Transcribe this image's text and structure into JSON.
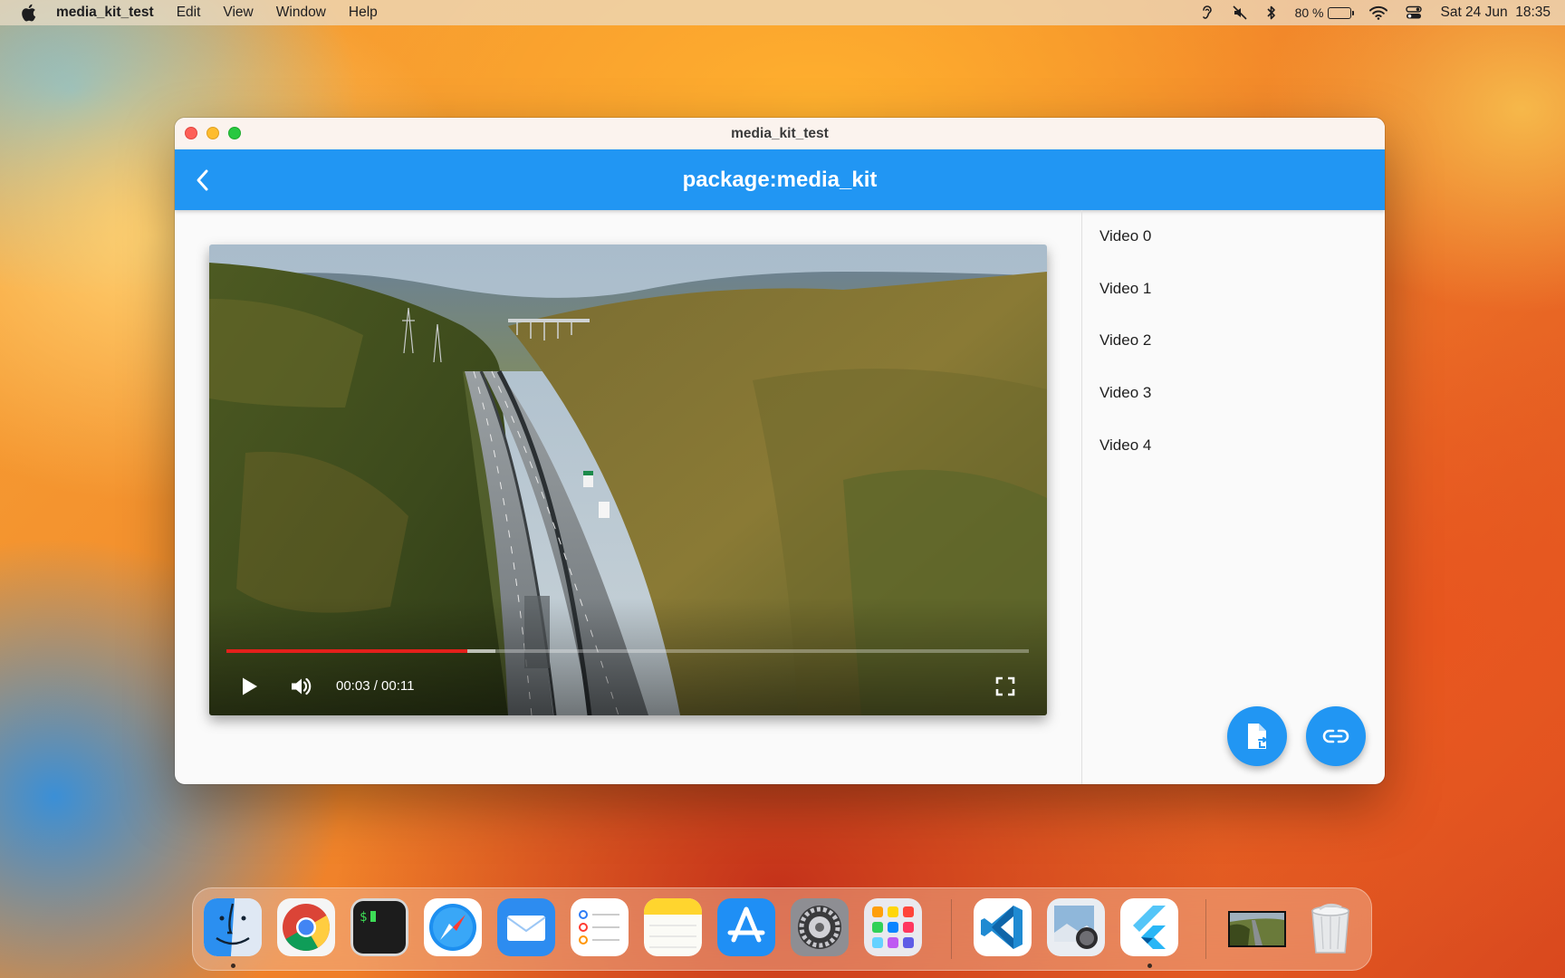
{
  "menubar": {
    "app_name": "media_kit_test",
    "items": [
      "Edit",
      "View",
      "Window",
      "Help"
    ],
    "battery": "80 %",
    "battery_level": 0.8,
    "datetime": "Sat 24 Jun  18:35"
  },
  "window": {
    "title": "media_kit_test",
    "appbar_title": "package:media_kit"
  },
  "player": {
    "time": "00:03 / 00:11",
    "played_fraction": 0.3,
    "buffered_fraction": 0.335
  },
  "video_list": [
    "Video 0",
    "Video 1",
    "Video 2",
    "Video 3",
    "Video 4"
  ],
  "fabs": {
    "open_file_icon": "file-open-icon",
    "open_url_icon": "link-icon"
  },
  "dock": {
    "apps": [
      "Finder",
      "Google Chrome",
      "Terminal",
      "Safari",
      "Mail",
      "Reminders",
      "Notes",
      "App Store",
      "System Settings",
      "Launchpad",
      "Visual Studio Code",
      "Preview",
      "Flutter",
      "Video",
      "Trash"
    ]
  },
  "colors": {
    "appbar": "#2196f3",
    "seek_played": "#e3201b",
    "fab": "#2196f3"
  }
}
